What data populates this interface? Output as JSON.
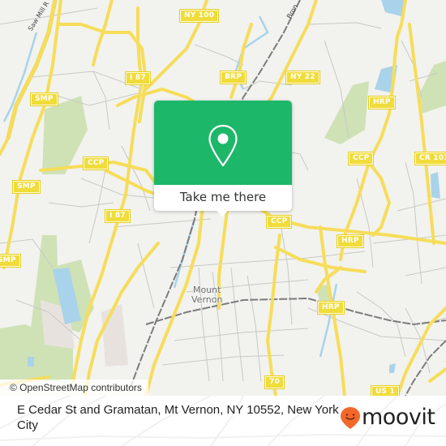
{
  "map": {
    "background_color": "#f2f2ef",
    "road_color": "#f6dd5a",
    "water_color": "#a9d3ea",
    "park_color": "#c9dfae",
    "attribution": "© OpenStreetMap contributors",
    "shields": [
      {
        "id": "ny100",
        "label": "NY 100"
      },
      {
        "id": "i87-top",
        "label": "I 87"
      },
      {
        "id": "smp-top",
        "label": "SMP"
      },
      {
        "id": "brp",
        "label": "BRP"
      },
      {
        "id": "ny22",
        "label": "NY 22"
      },
      {
        "id": "hrp-top",
        "label": "HRP"
      },
      {
        "id": "ccp-left",
        "label": "CCP"
      },
      {
        "id": "smp-mid",
        "label": "SMP"
      },
      {
        "id": "ccp-right",
        "label": "CCP"
      },
      {
        "id": "cr101",
        "label": "CR 101"
      },
      {
        "id": "i87-mid",
        "label": "I 87"
      },
      {
        "id": "ccp-center",
        "label": "CCP"
      },
      {
        "id": "hrp-mid",
        "label": "HRP"
      },
      {
        "id": "smp-bottom",
        "label": "SMP"
      },
      {
        "id": "hrp-bottom",
        "label": "HRP"
      },
      {
        "id": "r70",
        "label": "70"
      },
      {
        "id": "us1",
        "label": "US 1"
      }
    ],
    "places": [
      {
        "id": "mount-vernon",
        "label": "Mount\nVernon"
      }
    ],
    "road_labels": [
      {
        "id": "saw-mill",
        "label": "Saw Mill R"
      },
      {
        "id": "bronx-river",
        "label": "Bron"
      }
    ]
  },
  "popup": {
    "accent_color": "#1db76a",
    "icon": "location-pin-icon",
    "cta_label": "Take me there"
  },
  "footer": {
    "address": "E Cedar St and Gramatan, Mt Vernon, NY 10552, New York City",
    "brand": {
      "name": "moovit",
      "icon": "moovit-smiley-pin-icon",
      "color": "#f2682a"
    }
  }
}
